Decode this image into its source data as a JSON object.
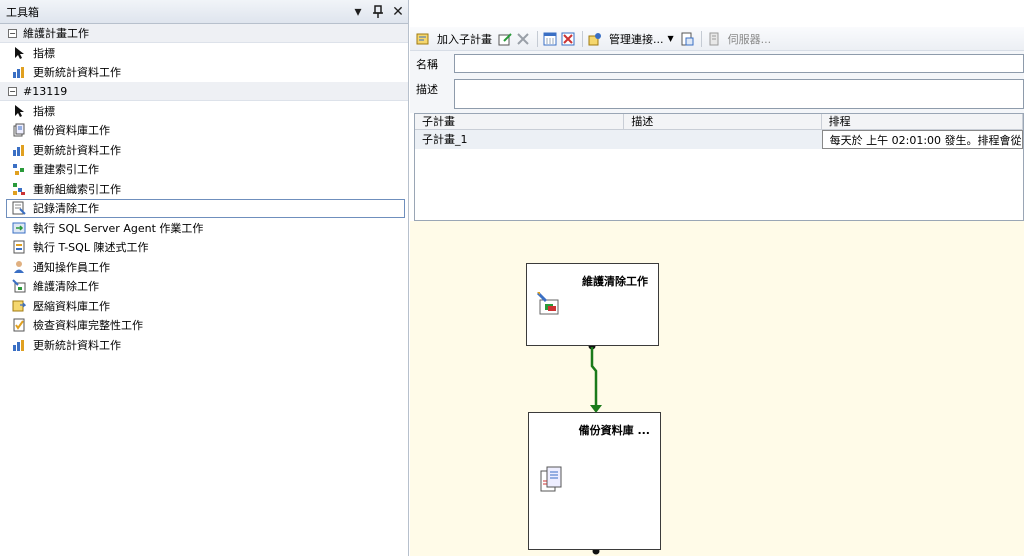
{
  "toolbox": {
    "title": "工具箱",
    "dropdown_glyph": "▾",
    "pin_glyph": "ㅍ",
    "close_glyph": "✕",
    "groups": [
      {
        "label": "維護計畫工作",
        "items": [
          {
            "label": "指標",
            "icon": "pointer-icon"
          },
          {
            "label": "更新統計資料工作",
            "icon": "statistics-icon"
          }
        ]
      },
      {
        "label": "#13119",
        "items": [
          {
            "label": "指標",
            "icon": "pointer-icon"
          },
          {
            "label": "備份資料庫工作",
            "icon": "backup-icon"
          },
          {
            "label": "更新統計資料工作",
            "icon": "statistics-icon"
          },
          {
            "label": "重建索引工作",
            "icon": "rebuild-index-icon"
          },
          {
            "label": "重新組織索引工作",
            "icon": "reorganize-index-icon"
          },
          {
            "label": "記錄清除工作",
            "icon": "history-cleanup-icon",
            "selected": true
          },
          {
            "label": "執行 SQL Server Agent 作業工作",
            "icon": "agent-job-icon"
          },
          {
            "label": "執行 T-SQL 陳述式工作",
            "icon": "tsql-icon"
          },
          {
            "label": "通知操作員工作",
            "icon": "notify-operator-icon"
          },
          {
            "label": "維護清除工作",
            "icon": "maintenance-cleanup-icon"
          },
          {
            "label": "壓縮資料庫工作",
            "icon": "shrink-db-icon"
          },
          {
            "label": "檢查資料庫完整性工作",
            "icon": "check-integrity-icon"
          },
          {
            "label": "更新統計資料工作",
            "icon": "statistics-icon"
          }
        ]
      }
    ]
  },
  "toolbar": {
    "add_subplan": "加入子計畫",
    "manage_connections": "管理連接...",
    "server": "伺服器..."
  },
  "props": {
    "name_label": "名稱",
    "name_value": "",
    "desc_label": "描述",
    "desc_value": ""
  },
  "grid": {
    "headers": [
      "子計畫",
      "描述",
      "排程"
    ],
    "rows": [
      {
        "subplan": "子計畫_1",
        "description": "",
        "schedule": "每天於 上午 02:01:00 發生。排程會從"
      }
    ]
  },
  "canvas": {
    "tasks": [
      {
        "title": "維護清除工作",
        "icon": "maintenance-cleanup-icon"
      },
      {
        "title": "備份資料庫 ...",
        "icon": "backup-icon"
      }
    ]
  },
  "colors": {
    "canvas_bg": "#fffbe8",
    "connector": "#1a7a1a",
    "selection_border": "#6f8fbd"
  }
}
